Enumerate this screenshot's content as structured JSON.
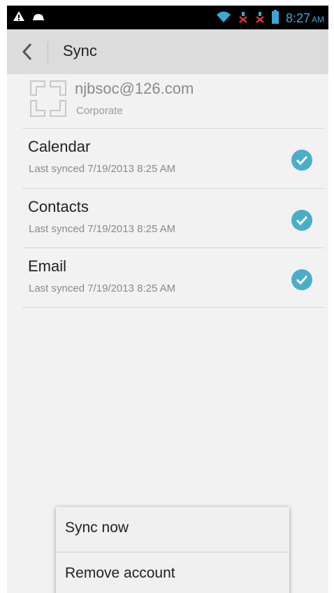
{
  "status_bar": {
    "time": "8:27",
    "ampm": "AM",
    "icons": [
      "warning-icon",
      "notification-icon",
      "wifi-icon",
      "no-signal-icon",
      "no-signal-icon",
      "battery-icon"
    ]
  },
  "app_bar": {
    "title": "Sync"
  },
  "account": {
    "email": "njbsoc@126.com",
    "type": "Corporate"
  },
  "sync_items": [
    {
      "name": "Calendar",
      "last_synced": "Last synced 7/19/2013 8:25 AM",
      "checked": true
    },
    {
      "name": "Contacts",
      "last_synced": "Last synced 7/19/2013 8:25 AM",
      "checked": true
    },
    {
      "name": "Email",
      "last_synced": "Last synced 7/19/2013 8:25 AM",
      "checked": true
    }
  ],
  "menu": {
    "items": [
      "Sync now",
      "Remove account"
    ]
  },
  "colors": {
    "accent": "#3aa7d8",
    "check": "#4aaec9"
  }
}
